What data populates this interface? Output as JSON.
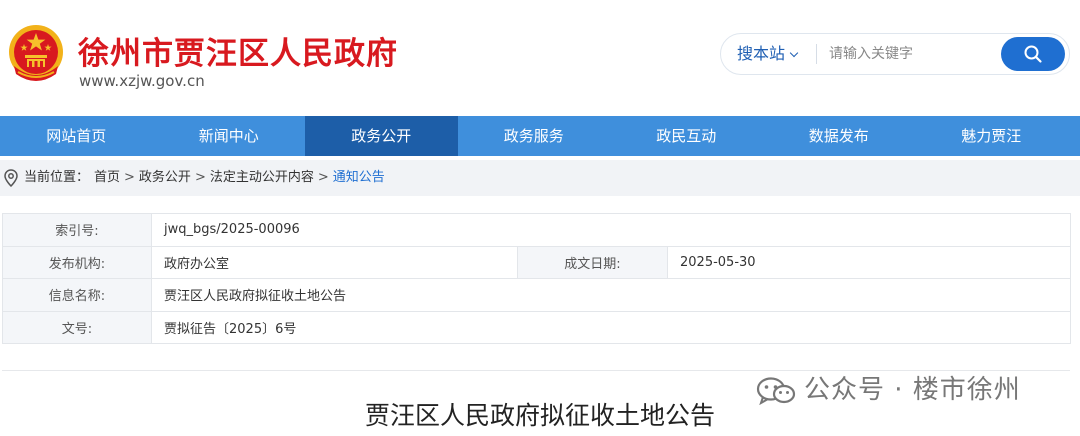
{
  "header": {
    "site_title": "徐州市贾汪区人民政府",
    "site_domain": "www.xzjw.gov.cn",
    "emblem_icon": "national-emblem-icon",
    "brand_color": "#d8191f"
  },
  "search": {
    "scope_label": "搜本站",
    "placeholder": "请输入关键字",
    "button_icon": "search-icon",
    "accent_color": "#1f6fd1"
  },
  "nav": {
    "items": [
      {
        "label": "网站首页"
      },
      {
        "label": "新闻中心"
      },
      {
        "label": "政务公开"
      },
      {
        "label": "政务服务"
      },
      {
        "label": "政民互动"
      },
      {
        "label": "数据发布"
      },
      {
        "label": "魅力贾汪"
      }
    ],
    "active_index": 2,
    "bar_color": "#3f8fdc",
    "active_color": "#1d5ea8"
  },
  "breadcrumb": {
    "label": "当前位置：",
    "icon": "location-pin-icon",
    "items": [
      "首页",
      "政务公开",
      "法定主动公开内容",
      "通知公告"
    ],
    "separator": ">"
  },
  "info": {
    "index_label": "索引号:",
    "index_value": "jwq_bgs/2025-00096",
    "org_label": "发布机构:",
    "org_value": "政府办公室",
    "date_label": "成文日期:",
    "date_value": "2025-05-30",
    "name_label": "信息名称:",
    "name_value": "贾汪区人民政府拟征收土地公告",
    "doc_label": "文号:",
    "doc_value": "贾拟征告〔2025〕6号"
  },
  "article": {
    "title": "贾汪区人民政府拟征收土地公告"
  },
  "watermark": {
    "icon": "wechat-icon",
    "text": "公众号 · 楼市徐州"
  }
}
